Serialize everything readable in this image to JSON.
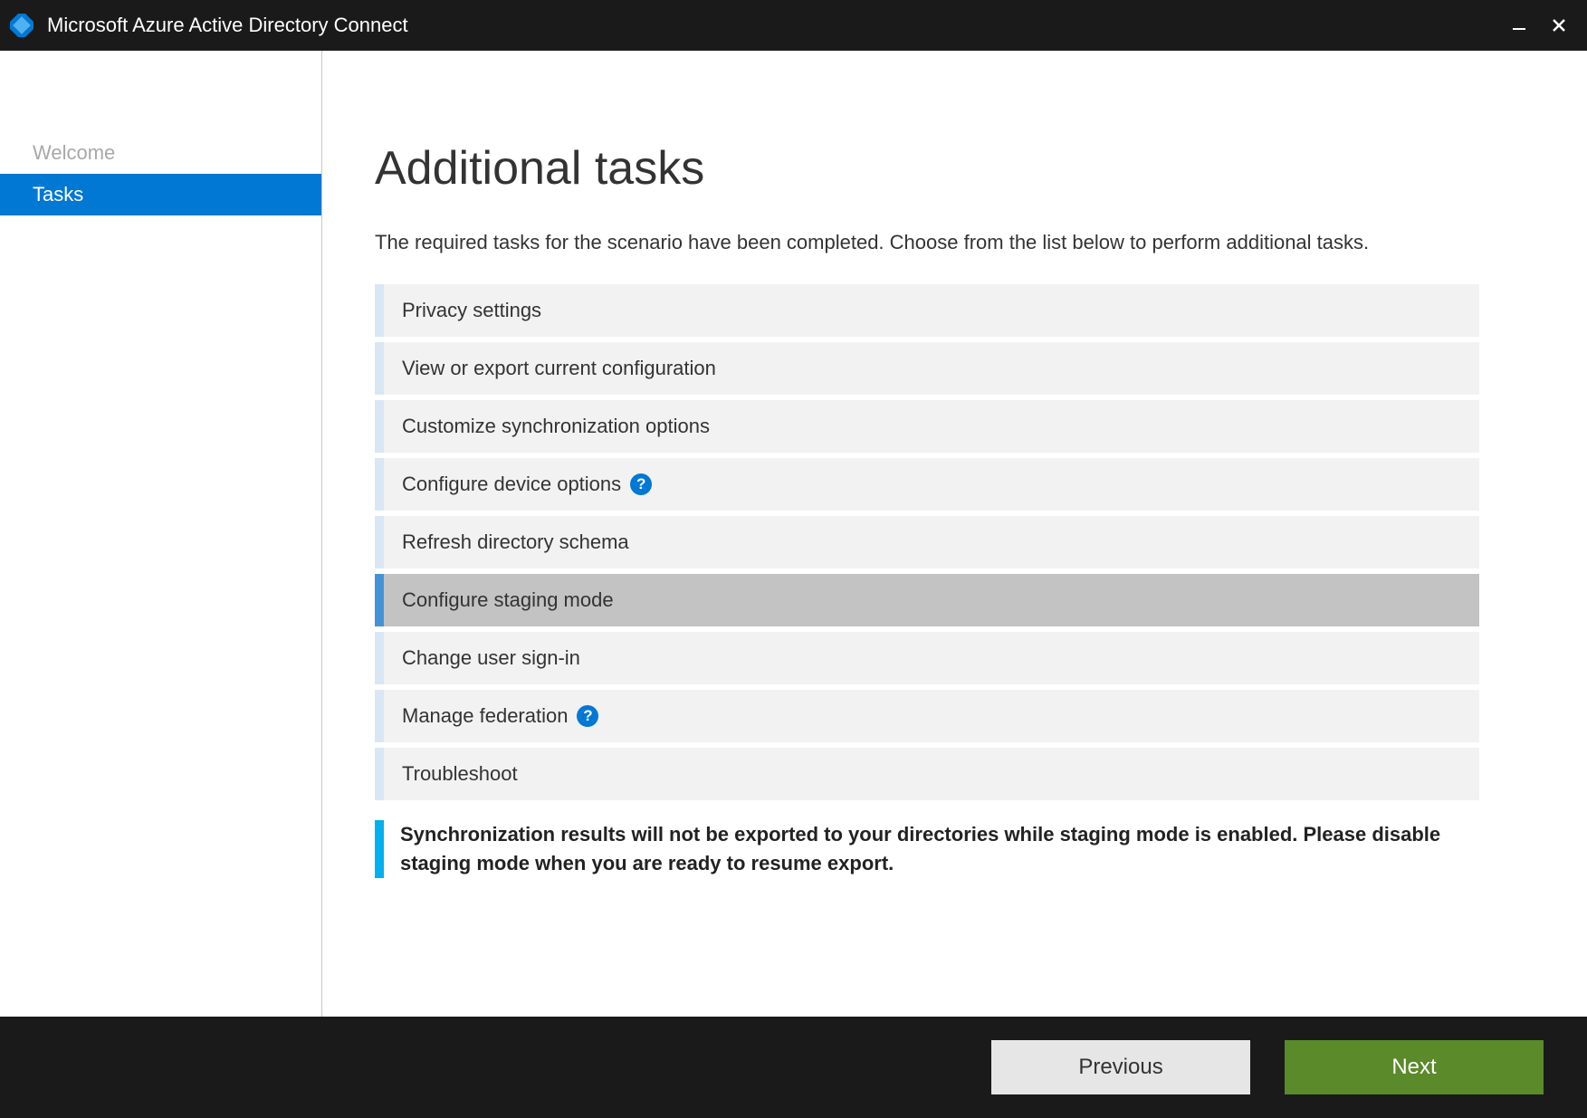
{
  "titlebar": {
    "title": "Microsoft Azure Active Directory Connect"
  },
  "sidebar": {
    "steps": [
      {
        "label": "Welcome",
        "current": false
      },
      {
        "label": "Tasks",
        "current": true
      }
    ]
  },
  "main": {
    "heading": "Additional tasks",
    "intro": "The required tasks for the scenario have been completed. Choose from the list below to perform additional tasks.",
    "tasks": [
      {
        "label": "Privacy settings",
        "help": false,
        "selected": false
      },
      {
        "label": "View or export current configuration",
        "help": false,
        "selected": false
      },
      {
        "label": "Customize synchronization options",
        "help": false,
        "selected": false
      },
      {
        "label": "Configure device options",
        "help": true,
        "selected": false
      },
      {
        "label": "Refresh directory schema",
        "help": false,
        "selected": false
      },
      {
        "label": "Configure staging mode",
        "help": false,
        "selected": true
      },
      {
        "label": "Change user sign-in",
        "help": false,
        "selected": false
      },
      {
        "label": "Manage federation",
        "help": true,
        "selected": false
      },
      {
        "label": "Troubleshoot",
        "help": false,
        "selected": false
      }
    ],
    "notice": "Synchronization results will not be exported to your directories while staging mode is enabled. Please disable staging mode when you are ready to resume export."
  },
  "footer": {
    "previous_label": "Previous",
    "next_label": "Next"
  },
  "icons": {
    "help_glyph": "?"
  },
  "colors": {
    "accent": "#0078d4",
    "next_button": "#5a8a2a",
    "notice_stripe": "#00b0f0"
  }
}
